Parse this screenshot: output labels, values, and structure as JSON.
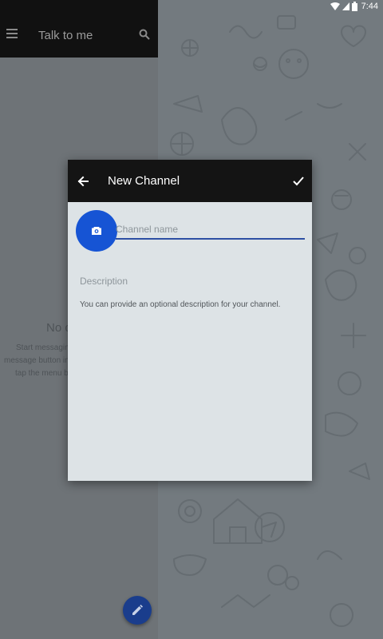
{
  "status_bar": {
    "time": "7:44"
  },
  "dialogs_list": {
    "title": "Talk to me",
    "empty_title": "No c",
    "empty_lines": [
      "Start messagin",
      "message button in",
      "tap the menu bu"
    ]
  },
  "new_channel": {
    "title": "New Channel",
    "name_placeholder": "Channel name",
    "description_placeholder": "Description",
    "description_hint": "You can provide an optional description for your channel."
  },
  "colors": {
    "accent": "#1654d4",
    "toolbar": "#141414",
    "dialog_background": "#dde3e6",
    "fab": "#1a3d8c"
  },
  "icons": [
    "menu-icon",
    "search-icon",
    "back-arrow-icon",
    "checkmark-icon",
    "camera-icon",
    "pencil-icon",
    "wifi-icon",
    "signal-icon",
    "battery-icon"
  ]
}
